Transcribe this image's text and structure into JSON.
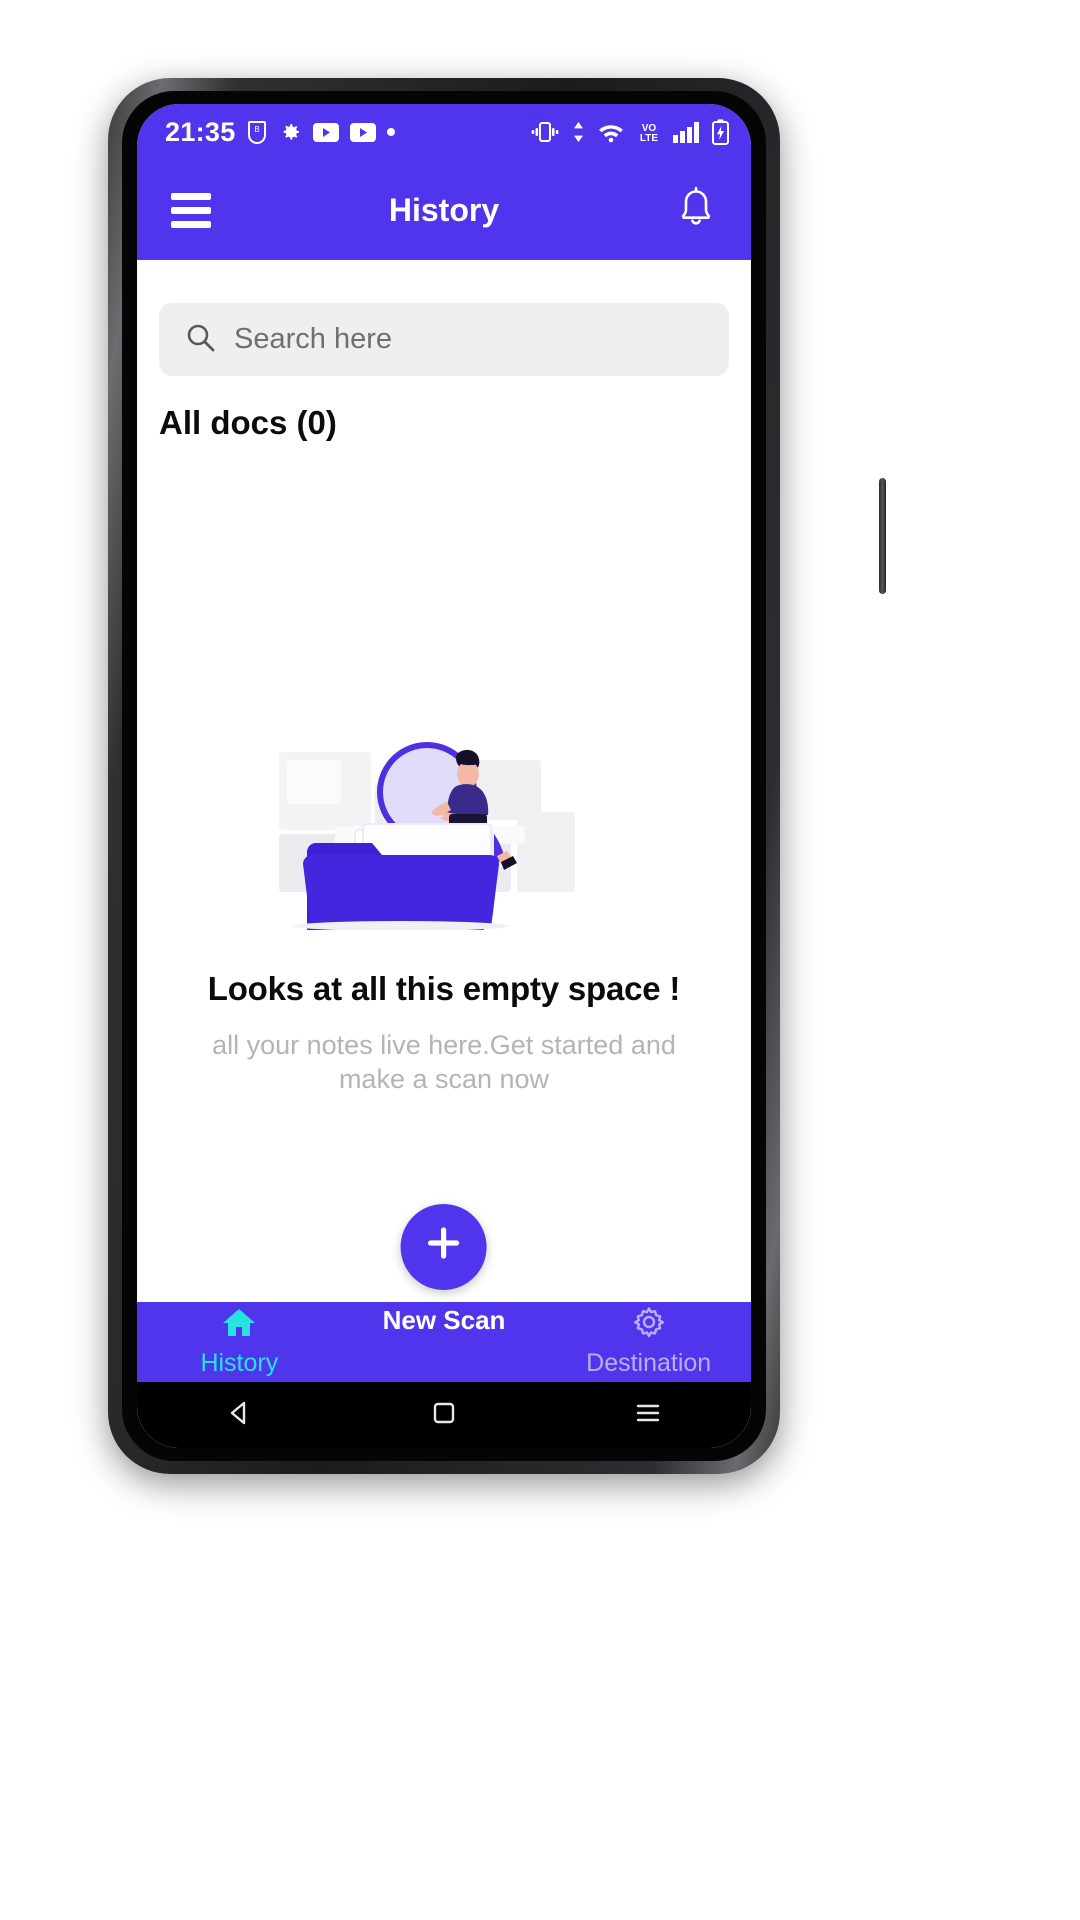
{
  "statusbar": {
    "time": "21:35",
    "left_icons": [
      "usb-icon",
      "gear-icon",
      "youtube-icon",
      "youtube-icon",
      "dot-icon"
    ],
    "right_icons": [
      "vibrate-icon",
      "data-transfer-icon",
      "wifi-icon",
      "volte-icon",
      "signal-bars-icon",
      "battery-charging-icon"
    ],
    "volte_label_top": "VO",
    "volte_label_bottom": "LTE"
  },
  "appbar": {
    "menu_icon": "hamburger-menu-icon",
    "title": "History",
    "notification_icon": "bell-icon"
  },
  "search": {
    "icon": "search-icon",
    "placeholder": "Search here",
    "value": ""
  },
  "section": {
    "all_docs_label": "All docs (0)"
  },
  "empty_state": {
    "illustration": "empty-folder-illustration",
    "title": "Looks at all this empty space !",
    "subtitle": "all your notes live here.Get started and make a scan now"
  },
  "bottom_nav": {
    "items": [
      {
        "label": "History",
        "icon": "home-icon",
        "active": true
      },
      {
        "label": "Destination",
        "icon": "gear-icon",
        "active": false
      }
    ],
    "fab": {
      "label": "New Scan",
      "icon": "plus-icon"
    }
  },
  "android_nav": {
    "back": "back-triangle-icon",
    "home": "home-square-icon",
    "recents": "recents-lines-icon"
  },
  "colors": {
    "brand": "#4f36ec",
    "accent": "#27e2e2",
    "search_bg": "#efefef",
    "muted_text": "#b4b4b4"
  }
}
